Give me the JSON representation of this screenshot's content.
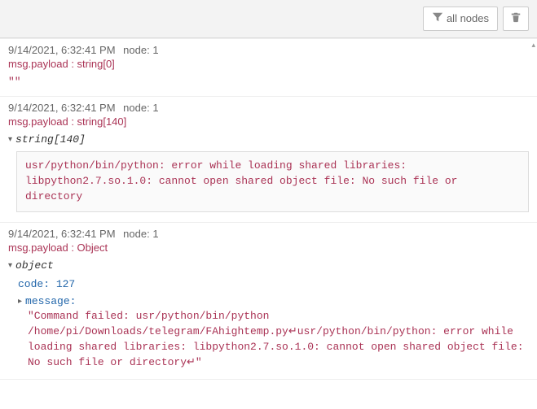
{
  "toolbar": {
    "filter_label": "all nodes"
  },
  "messages": [
    {
      "timestamp": "9/14/2021, 6:32:41 PM",
      "node": "node: 1",
      "topic": "msg.payload : string[0]",
      "body_type": "string-literal",
      "literal": "\"\""
    },
    {
      "timestamp": "9/14/2021, 6:32:41 PM",
      "node": "node: 1",
      "topic": "msg.payload : string[140]",
      "body_type": "string-expanded",
      "type_label": "string[140]",
      "string_value": "usr/python/bin/python: error while loading shared libraries: libpython2.7.so.1.0: cannot open shared object file: No such file or directory"
    },
    {
      "timestamp": "9/14/2021, 6:32:41 PM",
      "node": "node: 1",
      "topic": "msg.payload : Object",
      "body_type": "object",
      "type_label": "object",
      "object": {
        "code_key": "code:",
        "code_value": "127",
        "message_key": "message:",
        "message_value": "\"Command failed: usr/python/bin/python /home/pi/Downloads/telegram/FAhightemp.py↵usr/python/bin/python: error while loading shared libraries: libpython2.7.so.1.0: cannot open shared object file: No such file or directory↵\""
      }
    }
  ]
}
